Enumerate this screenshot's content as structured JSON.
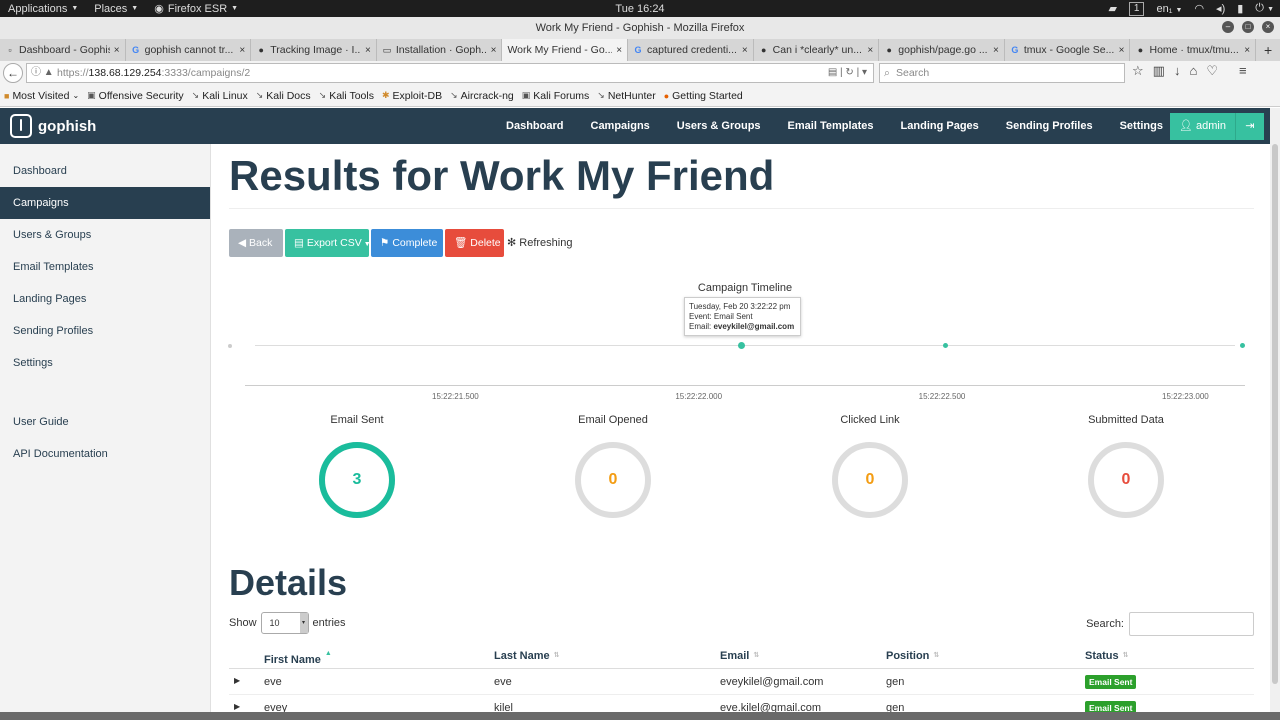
{
  "system_bar": {
    "applications": "Applications",
    "places": "Places",
    "browser_app": "Firefox ESR",
    "clock": "Tue 16:24",
    "workspace": "1",
    "keyboard": "en₁"
  },
  "window": {
    "title": "Work My Friend - Gophish - Mozilla Firefox"
  },
  "tabs": [
    {
      "label": "Dashboard - Gophish",
      "icon": "page-icon"
    },
    {
      "label": "gophish cannot tr...",
      "icon": "google-icon"
    },
    {
      "label": "Tracking Image · I...",
      "icon": "github-icon"
    },
    {
      "label": "Installation · Goph...",
      "icon": "book-icon"
    },
    {
      "label": "Work My Friend - Go...",
      "icon": "page-icon"
    },
    {
      "label": "captured credenti...",
      "icon": "google-icon"
    },
    {
      "label": "Can i *clearly* un...",
      "icon": "github-icon"
    },
    {
      "label": "gophish/page.go ...",
      "icon": "github-icon"
    },
    {
      "label": "tmux - Google Se...",
      "icon": "google-icon"
    },
    {
      "label": "Home · tmux/tmu...",
      "icon": "github-icon"
    }
  ],
  "url": {
    "prefix": "https://",
    "host": "138.68.129.254",
    "path": ":3333/campaigns/2"
  },
  "search": {
    "placeholder": "Search"
  },
  "bookmarks": [
    "Most Visited",
    "Offensive Security",
    "Kali Linux",
    "Kali Docs",
    "Kali Tools",
    "Exploit-DB",
    "Aircrack-ng",
    "Kali Forums",
    "NetHunter",
    "Getting Started"
  ],
  "app": {
    "brand": "gophish",
    "nav": [
      "Dashboard",
      "Campaigns",
      "Users & Groups",
      "Email Templates",
      "Landing Pages",
      "Sending Profiles",
      "Settings"
    ],
    "admin_label": "admin",
    "sidebar": [
      "Dashboard",
      "Campaigns",
      "Users & Groups",
      "Email Templates",
      "Landing Pages",
      "Sending Profiles",
      "Settings"
    ],
    "sidebar_bottom": [
      "User Guide",
      "API Documentation"
    ],
    "active_sidebar": "Campaigns"
  },
  "page": {
    "title": "Results for Work My Friend",
    "buttons": {
      "back": "Back",
      "export": "Export CSV",
      "complete": "Complete",
      "delete": "Delete",
      "refreshing": "Refreshing"
    }
  },
  "chart_data": {
    "type": "scatter",
    "title": "Campaign Timeline",
    "x_ticks": [
      "15:22:21.500",
      "15:22:22.000",
      "15:22:22.500",
      "15:22:23.000"
    ],
    "tooltip": {
      "date": "Tuesday, Feb 20 3:22:22 pm",
      "event": "Event: Email Sent",
      "email_label": "Email: ",
      "email": "eveykilel@gmail.com"
    },
    "points": [
      {
        "time": "15:22:21.050",
        "kind": "start"
      },
      {
        "time": "15:22:22.100",
        "kind": "email-sent"
      },
      {
        "time": "15:22:22.520",
        "kind": "email-sent"
      },
      {
        "time": "15:22:23.130",
        "kind": "email-sent"
      }
    ]
  },
  "stats": [
    {
      "label": "Email Sent",
      "value": "3",
      "fraction": 1.0,
      "color": "#1abc9c"
    },
    {
      "label": "Email Opened",
      "value": "0",
      "fraction": 0.0,
      "color": "#f39c12"
    },
    {
      "label": "Clicked Link",
      "value": "0",
      "fraction": 0.0,
      "color": "#f39c12"
    },
    {
      "label": "Submitted Data",
      "value": "0",
      "fraction": 0.0,
      "color": "#e74c3c"
    }
  ],
  "details": {
    "title": "Details",
    "show_label": "Show",
    "entries_value": "10",
    "entries_label": "entries",
    "search_label": "Search:",
    "columns": [
      "First Name",
      "Last Name",
      "Email",
      "Position",
      "Status"
    ],
    "rows": [
      {
        "first": "eve",
        "last": "eve",
        "email": "eveykilel@gmail.com",
        "position": "gen",
        "status": "Email Sent"
      },
      {
        "first": "evey",
        "last": "kilel",
        "email": "eve.kilel@gmail.com",
        "position": "gen",
        "status": "Email Sent"
      }
    ]
  },
  "colors": {
    "navy": "#283f50",
    "teal": "#37c1a0",
    "blue": "#3c8dd9",
    "red": "#e74c3c",
    "badge_green": "#2ca02c"
  }
}
